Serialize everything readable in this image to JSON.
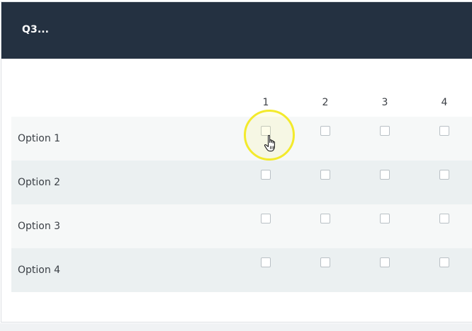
{
  "question": {
    "title": "Q3..."
  },
  "matrix": {
    "columns": [
      "1",
      "2",
      "3",
      "4"
    ],
    "rows": [
      {
        "label": "Option 1"
      },
      {
        "label": "Option 2"
      },
      {
        "label": "Option 3"
      },
      {
        "label": "Option 4"
      }
    ]
  },
  "colors": {
    "header_bg": "#243141",
    "row_light": "#f6f8f8",
    "row_dark": "#ebf0f1",
    "cursor_highlight": "#f3ea2c"
  },
  "icons": {
    "cursor": "hand-pointer-icon"
  }
}
